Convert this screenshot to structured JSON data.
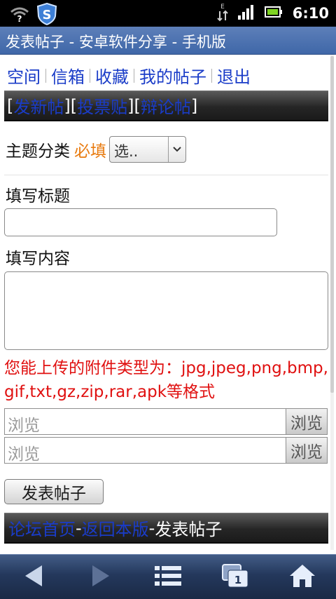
{
  "status_bar": {
    "time": "6:10",
    "network_label": "E"
  },
  "browser": {
    "title": "发表帖子 - 安卓软件分享 - 手机版",
    "window_count": "1"
  },
  "top_nav": {
    "items": [
      "空间",
      "信箱",
      "收藏",
      "我的帖子",
      "退出"
    ]
  },
  "post_types": {
    "open_bracket": "[",
    "between": "][",
    "close_bracket": "]",
    "items": [
      "发新帖",
      "投票贴",
      "辩论帖"
    ]
  },
  "form": {
    "category_label": "主题分类",
    "required_label": "必填",
    "category_select_value": "选..",
    "title_label": "填写标题",
    "title_value": "",
    "content_label": "填写内容",
    "content_value": "",
    "attachment_notice": "您能上传的附件类型为：jpg,jpeg,png,bmp,gif,txt,gz,zip,rar,apk等格式",
    "file_placeholder": "浏览",
    "browse_button": "浏览",
    "submit_button": "发表帖子"
  },
  "footer_nav": {
    "home_link": "论坛首页",
    "separator": "-",
    "back_link": "返回本版",
    "current": "发表帖子"
  },
  "colors": {
    "link": "#1a3cc8",
    "required": "#e87b10",
    "notice": "#e01010",
    "title_bar": "#4a6fae",
    "toolbar": "#24385c"
  }
}
